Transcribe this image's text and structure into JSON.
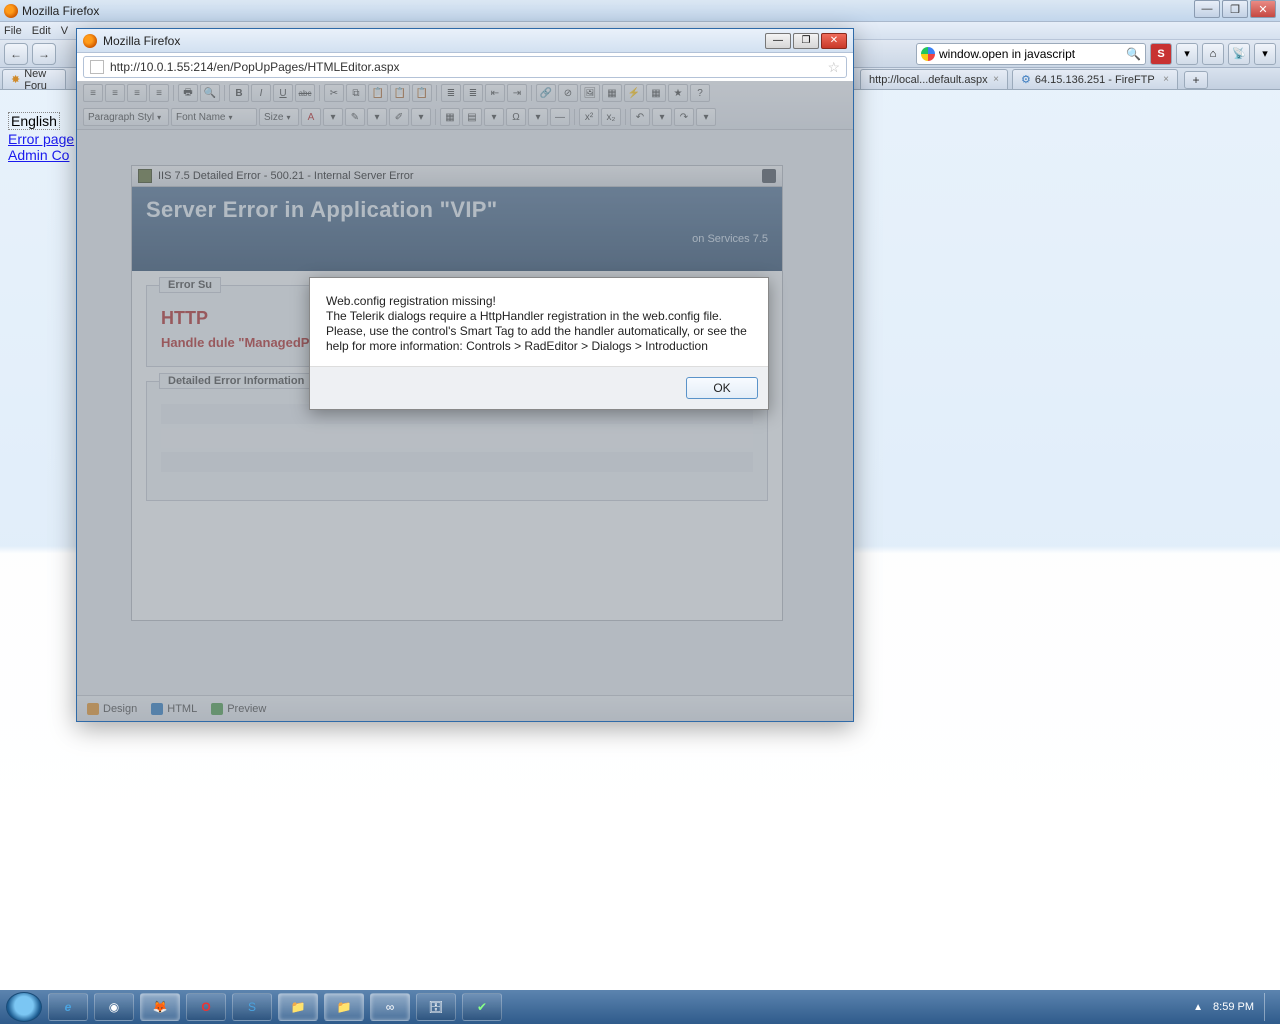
{
  "window": {
    "title": "Mozilla Firefox"
  },
  "win_buttons": {
    "min": "—",
    "max": "❐",
    "close": "✕"
  },
  "menu": {
    "file": "File",
    "edit": "Edit",
    "view": "V"
  },
  "nav": {
    "back": "←",
    "forward": "→"
  },
  "search": {
    "text": "window.open in javascript",
    "magnifier": "🔍"
  },
  "siteinfo_btn": "S",
  "tabs": {
    "t1": "New Foru",
    "t2": "http://local...default.aspx",
    "t3": "64.15.136.251 - FireFTP",
    "plus": "+"
  },
  "page": {
    "english": "English",
    "link1": "Error page",
    "link2": "Admin Co"
  },
  "popup": {
    "title": "Mozilla Firefox",
    "url": "http://10.0.1.55:214/en/PopUpPages/HTMLEditor.aspx",
    "buttons": {
      "min": "—",
      "max": "❐",
      "close": "✕"
    },
    "star": "☆"
  },
  "editor": {
    "combo_para": "Paragraph Styl",
    "combo_font": "Font Name",
    "combo_size": "Size",
    "b": "B",
    "i": "I",
    "u": "U",
    "s": "abc",
    "mode_design": "Design",
    "mode_html": "HTML",
    "mode_preview": "Preview"
  },
  "iis": {
    "titlebar": "IIS 7.5 Detailed Error - 500.21 - Internal Server Error",
    "banner_title": "Server Error in Application \"VIP\"",
    "banner_sub": "on Services 7.5",
    "section1_legend": "Error Su",
    "http_err": "HTTP",
    "http_text": "Handle                                                                   dule \"ManagedPipelineHandler\"  in its module list",
    "section2_legend": "Detailed Error Information"
  },
  "alert": {
    "line1": "Web.config registration missing!",
    "line2": " The Telerik dialogs require a HttpHandler registration in the web.config file.",
    "line3": "Please, use the control's Smart Tag to add the handler automatically, or see the",
    "line4": "help for more information: Controls > RadEditor > Dialogs > Introduction",
    "ok": "OK"
  },
  "taskbar": {
    "icons": {
      "ie": "e",
      "chrome": "◉",
      "ff": "🦊",
      "opera": "O",
      "skype": "S",
      "exp1": "📁",
      "exp2": "📁",
      "vs": "∞",
      "sql": "🗄",
      "tick": "✔"
    },
    "tray_arrow": "▲",
    "time": "8:59 PM"
  }
}
